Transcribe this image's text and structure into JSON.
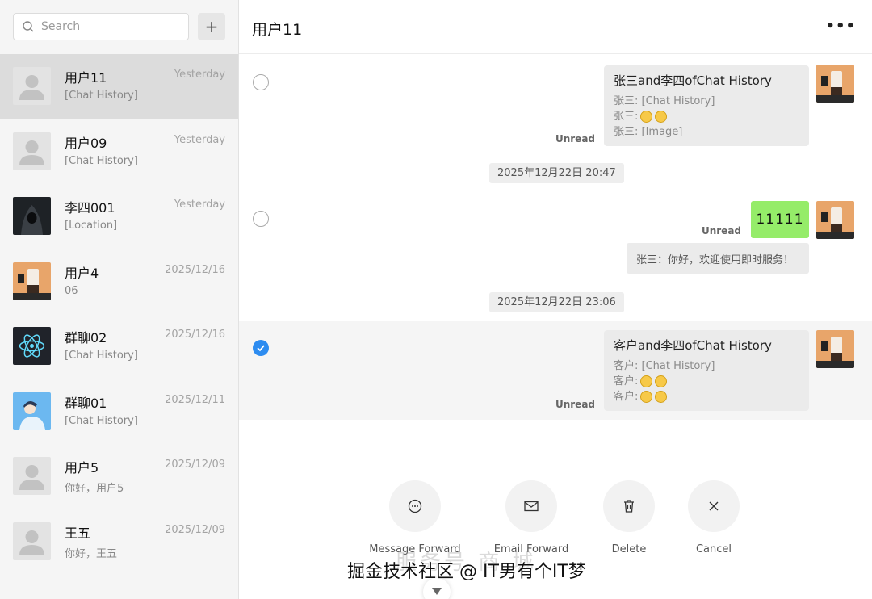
{
  "search": {
    "placeholder": "Search"
  },
  "sidebar": {
    "add_label": "+",
    "conversations": [
      {
        "name": "用户11",
        "time": "Yesterday",
        "preview": "[Chat History]",
        "avatar": "default-avatar",
        "active": true
      },
      {
        "name": "用户09",
        "time": "Yesterday",
        "preview": "[Chat History]",
        "avatar": "default-avatar"
      },
      {
        "name": "李四001",
        "time": "Yesterday",
        "preview": "[Location]",
        "avatar": "hooded-figure-avatar"
      },
      {
        "name": "用户4",
        "time": "2025/12/16",
        "preview": "06",
        "avatar": "milk-tea-avatar"
      },
      {
        "name": "群聊02",
        "time": "2025/12/16",
        "preview": "[Chat History]",
        "avatar": "react-atom-avatar"
      },
      {
        "name": "群聊01",
        "time": "2025/12/11",
        "preview": "[Chat History]",
        "avatar": "cartoon-person-avatar"
      },
      {
        "name": "用户5",
        "time": "2025/12/09",
        "preview": "你好，用户5",
        "avatar": "default-avatar"
      },
      {
        "name": "王五",
        "time": "2025/12/09",
        "preview": "你好，王五",
        "avatar": "default-avatar"
      }
    ]
  },
  "chat": {
    "title": "用户11",
    "more_label": "•••",
    "messages": [
      {
        "type": "chat-record",
        "title": "张三and李四ofChat History",
        "lines": [
          "张三: [Chat History]",
          "张三: ",
          "张三: [Image]"
        ],
        "status": "Unread",
        "selected": false
      },
      {
        "type": "time",
        "text": "2025年12月22日 20:47"
      },
      {
        "type": "text",
        "text": "11111",
        "status": "Unread",
        "selected": false
      },
      {
        "type": "notice",
        "text": "张三：你好，欢迎使用即时服务！"
      },
      {
        "type": "time",
        "text": "2025年12月22日 23:06"
      },
      {
        "type": "chat-record",
        "title": "客户and李四ofChat History",
        "lines": [
          "客户: [Chat History]",
          "客户: ",
          "客户: "
        ],
        "status": "Unread",
        "selected": true
      }
    ]
  },
  "actions": {
    "message_forward": "Message Forward",
    "email_forward": "Email Forward",
    "delete": "Delete",
    "cancel": "Cancel"
  },
  "watermark": {
    "text": "掘金技术社区 @ IT男有个IT梦",
    "ghost": "服务号 商 城"
  },
  "colors": {
    "accent_blue": "#2d8cf0",
    "bubble_green": "#95ec69",
    "active_item": "#dcdcdc",
    "sidebar_bg": "#f5f5f5"
  }
}
